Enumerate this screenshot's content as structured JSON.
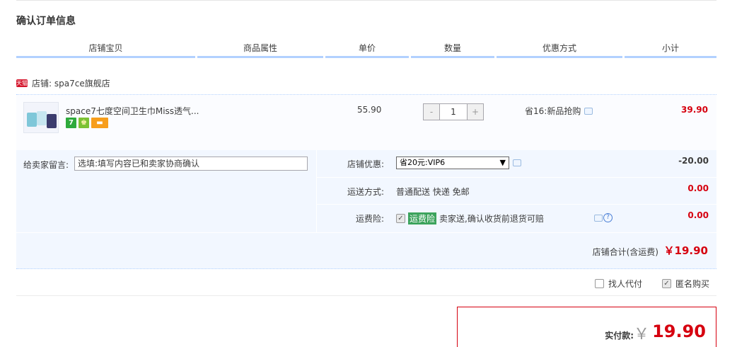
{
  "page_title": "确认订单信息",
  "table_headers": [
    "店铺宝贝",
    "商品属性",
    "单价",
    "数量",
    "优惠方式",
    "小计"
  ],
  "shop": {
    "badge": "天猫",
    "label": "店铺: spa7ce旗舰店"
  },
  "item": {
    "name": "space7七度空间卫生巾Miss透气...",
    "unit_price": "55.90",
    "qty_minus": "-",
    "quantity": "1",
    "qty_plus": "+",
    "promotion": "省16:新品抢购",
    "subtotal": "39.90"
  },
  "message": {
    "label": "给卖家留言:",
    "placeholder": "选填:填写内容已和卖家协商确认"
  },
  "order_options": {
    "shop_discount": {
      "label": "店铺优惠:",
      "selected": "省20元:VIP6",
      "amount": "-20.00"
    },
    "shipping": {
      "label": "运送方式:",
      "value": "普通配送 快递 免邮",
      "amount": "0.00"
    },
    "insurance": {
      "label": "运费险:",
      "tag": "运费险",
      "desc": "卖家送,确认收货前退货可赔",
      "amount": "0.00",
      "checked": true
    }
  },
  "shop_total": {
    "label": "店铺合计(含运费)",
    "value": "￥19.90"
  },
  "checkout_options": {
    "pay_for_me": {
      "label": "找人代付",
      "checked": false
    },
    "anonymous": {
      "label": "匿名购买",
      "checked": true
    }
  },
  "payment": {
    "label": "实付款:",
    "currency": "￥",
    "amount": "19.90"
  },
  "colors": {
    "accent_red": "#d6000f",
    "header_line": "#b2d1ff",
    "panel_bg": "#f2f7ff"
  }
}
